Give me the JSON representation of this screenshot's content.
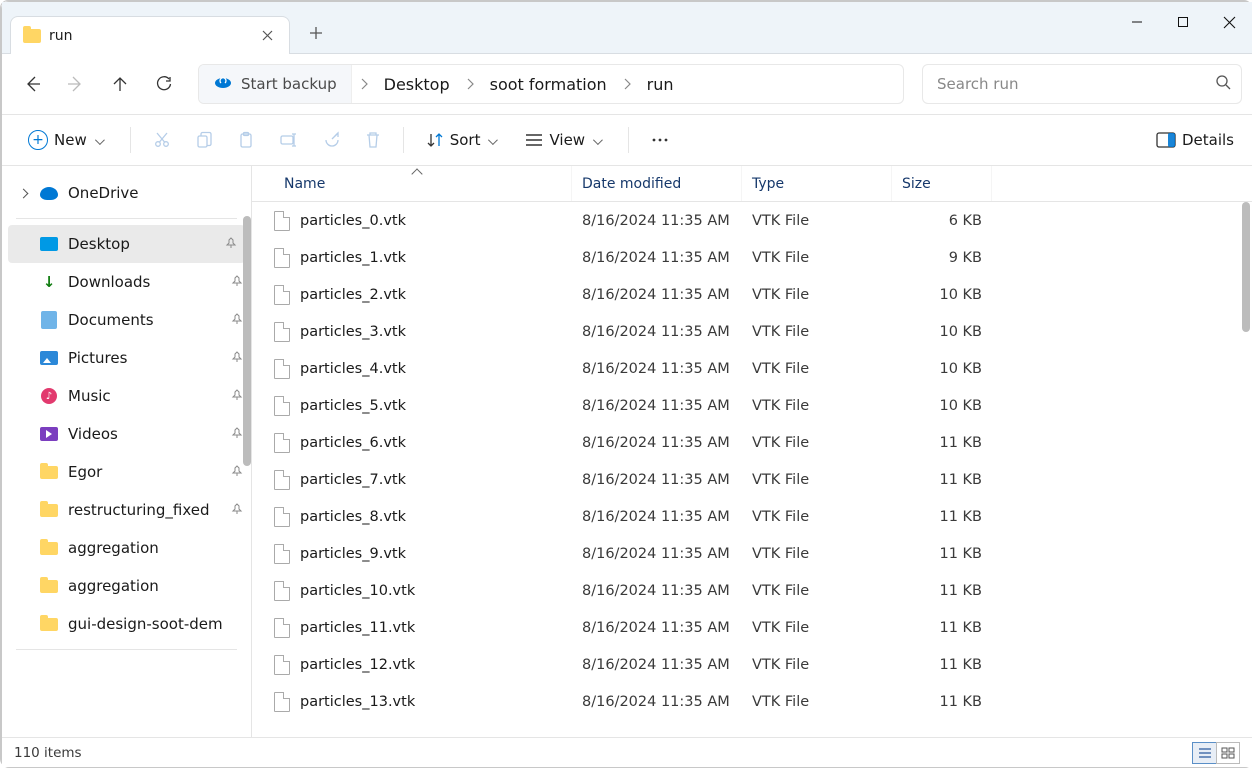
{
  "window": {
    "tab_title": "run"
  },
  "breadcrumb": {
    "backup_label": "Start backup",
    "segments": [
      "Desktop",
      "soot formation",
      "run"
    ]
  },
  "search": {
    "placeholder": "Search run"
  },
  "toolbar": {
    "new_label": "New",
    "sort_label": "Sort",
    "view_label": "View",
    "details_label": "Details"
  },
  "navpane": {
    "top": {
      "label": "OneDrive"
    },
    "pinned": [
      {
        "label": "Desktop",
        "icon": "desktop",
        "selected": true,
        "pin": true
      },
      {
        "label": "Downloads",
        "icon": "down",
        "selected": false,
        "pin": true
      },
      {
        "label": "Documents",
        "icon": "doc",
        "selected": false,
        "pin": true
      },
      {
        "label": "Pictures",
        "icon": "pic",
        "selected": false,
        "pin": true
      },
      {
        "label": "Music",
        "icon": "music",
        "selected": false,
        "pin": true
      },
      {
        "label": "Videos",
        "icon": "video",
        "selected": false,
        "pin": true
      },
      {
        "label": "Egor",
        "icon": "folder",
        "selected": false,
        "pin": true
      },
      {
        "label": "restructuring_fixed",
        "icon": "folder",
        "selected": false,
        "pin": true
      },
      {
        "label": "aggregation",
        "icon": "folder",
        "selected": false,
        "pin": false
      },
      {
        "label": "aggregation",
        "icon": "folder",
        "selected": false,
        "pin": false
      },
      {
        "label": "gui-design-soot-dem",
        "icon": "folder",
        "selected": false,
        "pin": false
      }
    ]
  },
  "columns": {
    "name": "Name",
    "date": "Date modified",
    "type": "Type",
    "size": "Size"
  },
  "files": [
    {
      "name": "particles_0.vtk",
      "date": "8/16/2024 11:35 AM",
      "type": "VTK File",
      "size": "6 KB"
    },
    {
      "name": "particles_1.vtk",
      "date": "8/16/2024 11:35 AM",
      "type": "VTK File",
      "size": "9 KB"
    },
    {
      "name": "particles_2.vtk",
      "date": "8/16/2024 11:35 AM",
      "type": "VTK File",
      "size": "10 KB"
    },
    {
      "name": "particles_3.vtk",
      "date": "8/16/2024 11:35 AM",
      "type": "VTK File",
      "size": "10 KB"
    },
    {
      "name": "particles_4.vtk",
      "date": "8/16/2024 11:35 AM",
      "type": "VTK File",
      "size": "10 KB"
    },
    {
      "name": "particles_5.vtk",
      "date": "8/16/2024 11:35 AM",
      "type": "VTK File",
      "size": "10 KB"
    },
    {
      "name": "particles_6.vtk",
      "date": "8/16/2024 11:35 AM",
      "type": "VTK File",
      "size": "11 KB"
    },
    {
      "name": "particles_7.vtk",
      "date": "8/16/2024 11:35 AM",
      "type": "VTK File",
      "size": "11 KB"
    },
    {
      "name": "particles_8.vtk",
      "date": "8/16/2024 11:35 AM",
      "type": "VTK File",
      "size": "11 KB"
    },
    {
      "name": "particles_9.vtk",
      "date": "8/16/2024 11:35 AM",
      "type": "VTK File",
      "size": "11 KB"
    },
    {
      "name": "particles_10.vtk",
      "date": "8/16/2024 11:35 AM",
      "type": "VTK File",
      "size": "11 KB"
    },
    {
      "name": "particles_11.vtk",
      "date": "8/16/2024 11:35 AM",
      "type": "VTK File",
      "size": "11 KB"
    },
    {
      "name": "particles_12.vtk",
      "date": "8/16/2024 11:35 AM",
      "type": "VTK File",
      "size": "11 KB"
    },
    {
      "name": "particles_13.vtk",
      "date": "8/16/2024 11:35 AM",
      "type": "VTK File",
      "size": "11 KB"
    }
  ],
  "status": {
    "count": "110 items"
  }
}
